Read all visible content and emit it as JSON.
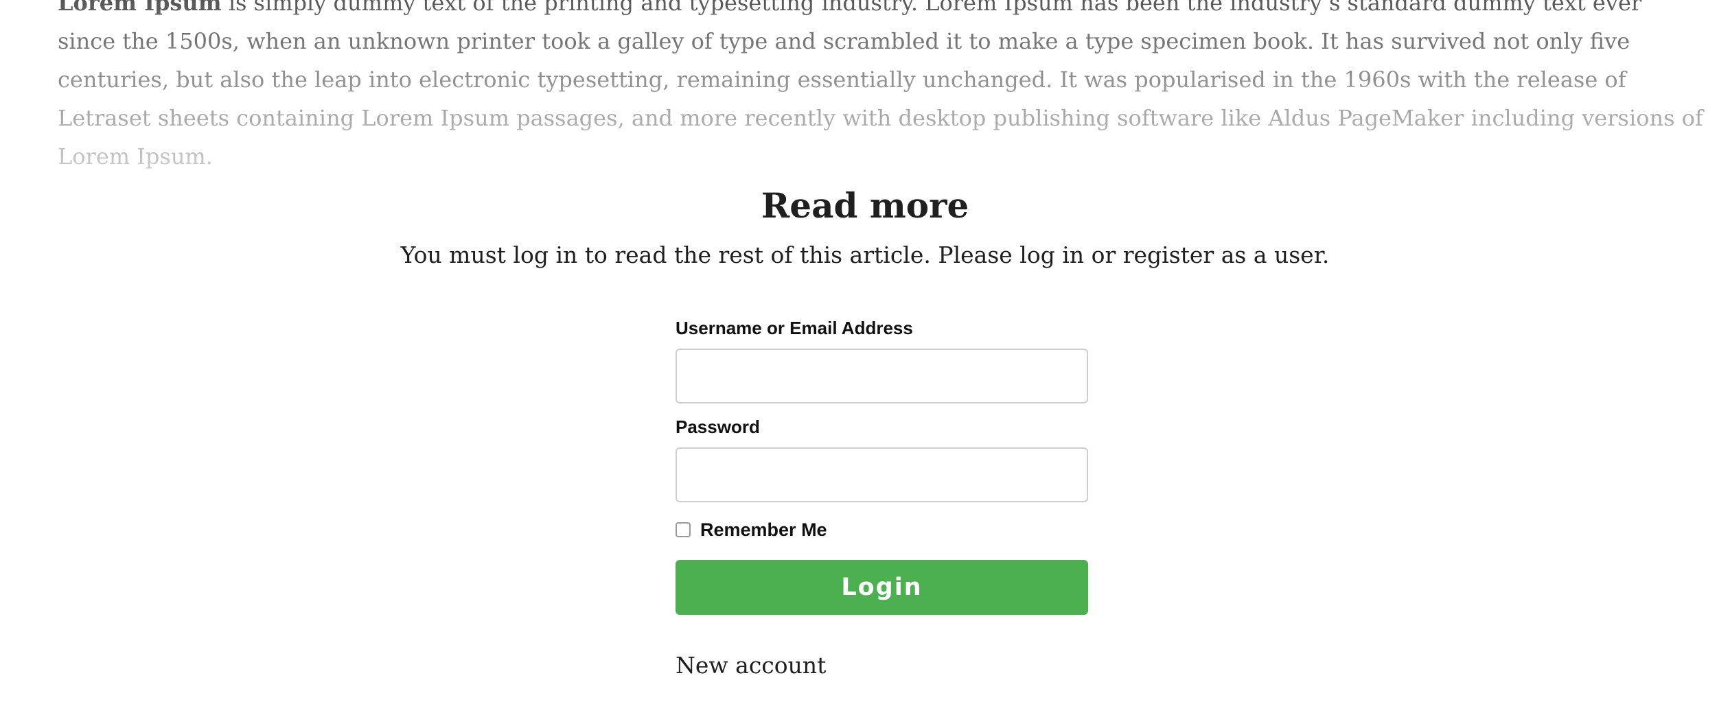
{
  "article": {
    "excerpt_lead": "Lorem Ipsum",
    "excerpt_body": " is simply dummy text of the printing and typesetting industry. Lorem Ipsum has been the industry’s standard dummy text ever since the 1500s, when an unknown printer took a galley of type and scrambled it to make a type specimen book. It has survived not only five centuries, but also the leap into electronic typesetting, remaining essentially unchanged. It was popularised in the 1960s with the release of Letraset sheets containing Lorem Ipsum passages, and more recently with desktop publishing software like Aldus PageMaker including versions of Lorem Ipsum."
  },
  "gate": {
    "title": "Read more",
    "message": "You must log in to read the rest of this article. Please log in or register as a user."
  },
  "login_form": {
    "username_label": "Username or Email Address",
    "username_value": "",
    "password_label": "Password",
    "password_value": "",
    "remember_label": "Remember Me",
    "remember_checked": false,
    "submit_label": "Login",
    "new_account_label": "New account"
  },
  "colors": {
    "login_button": "#4caf50",
    "text": "#1f1f1f"
  }
}
